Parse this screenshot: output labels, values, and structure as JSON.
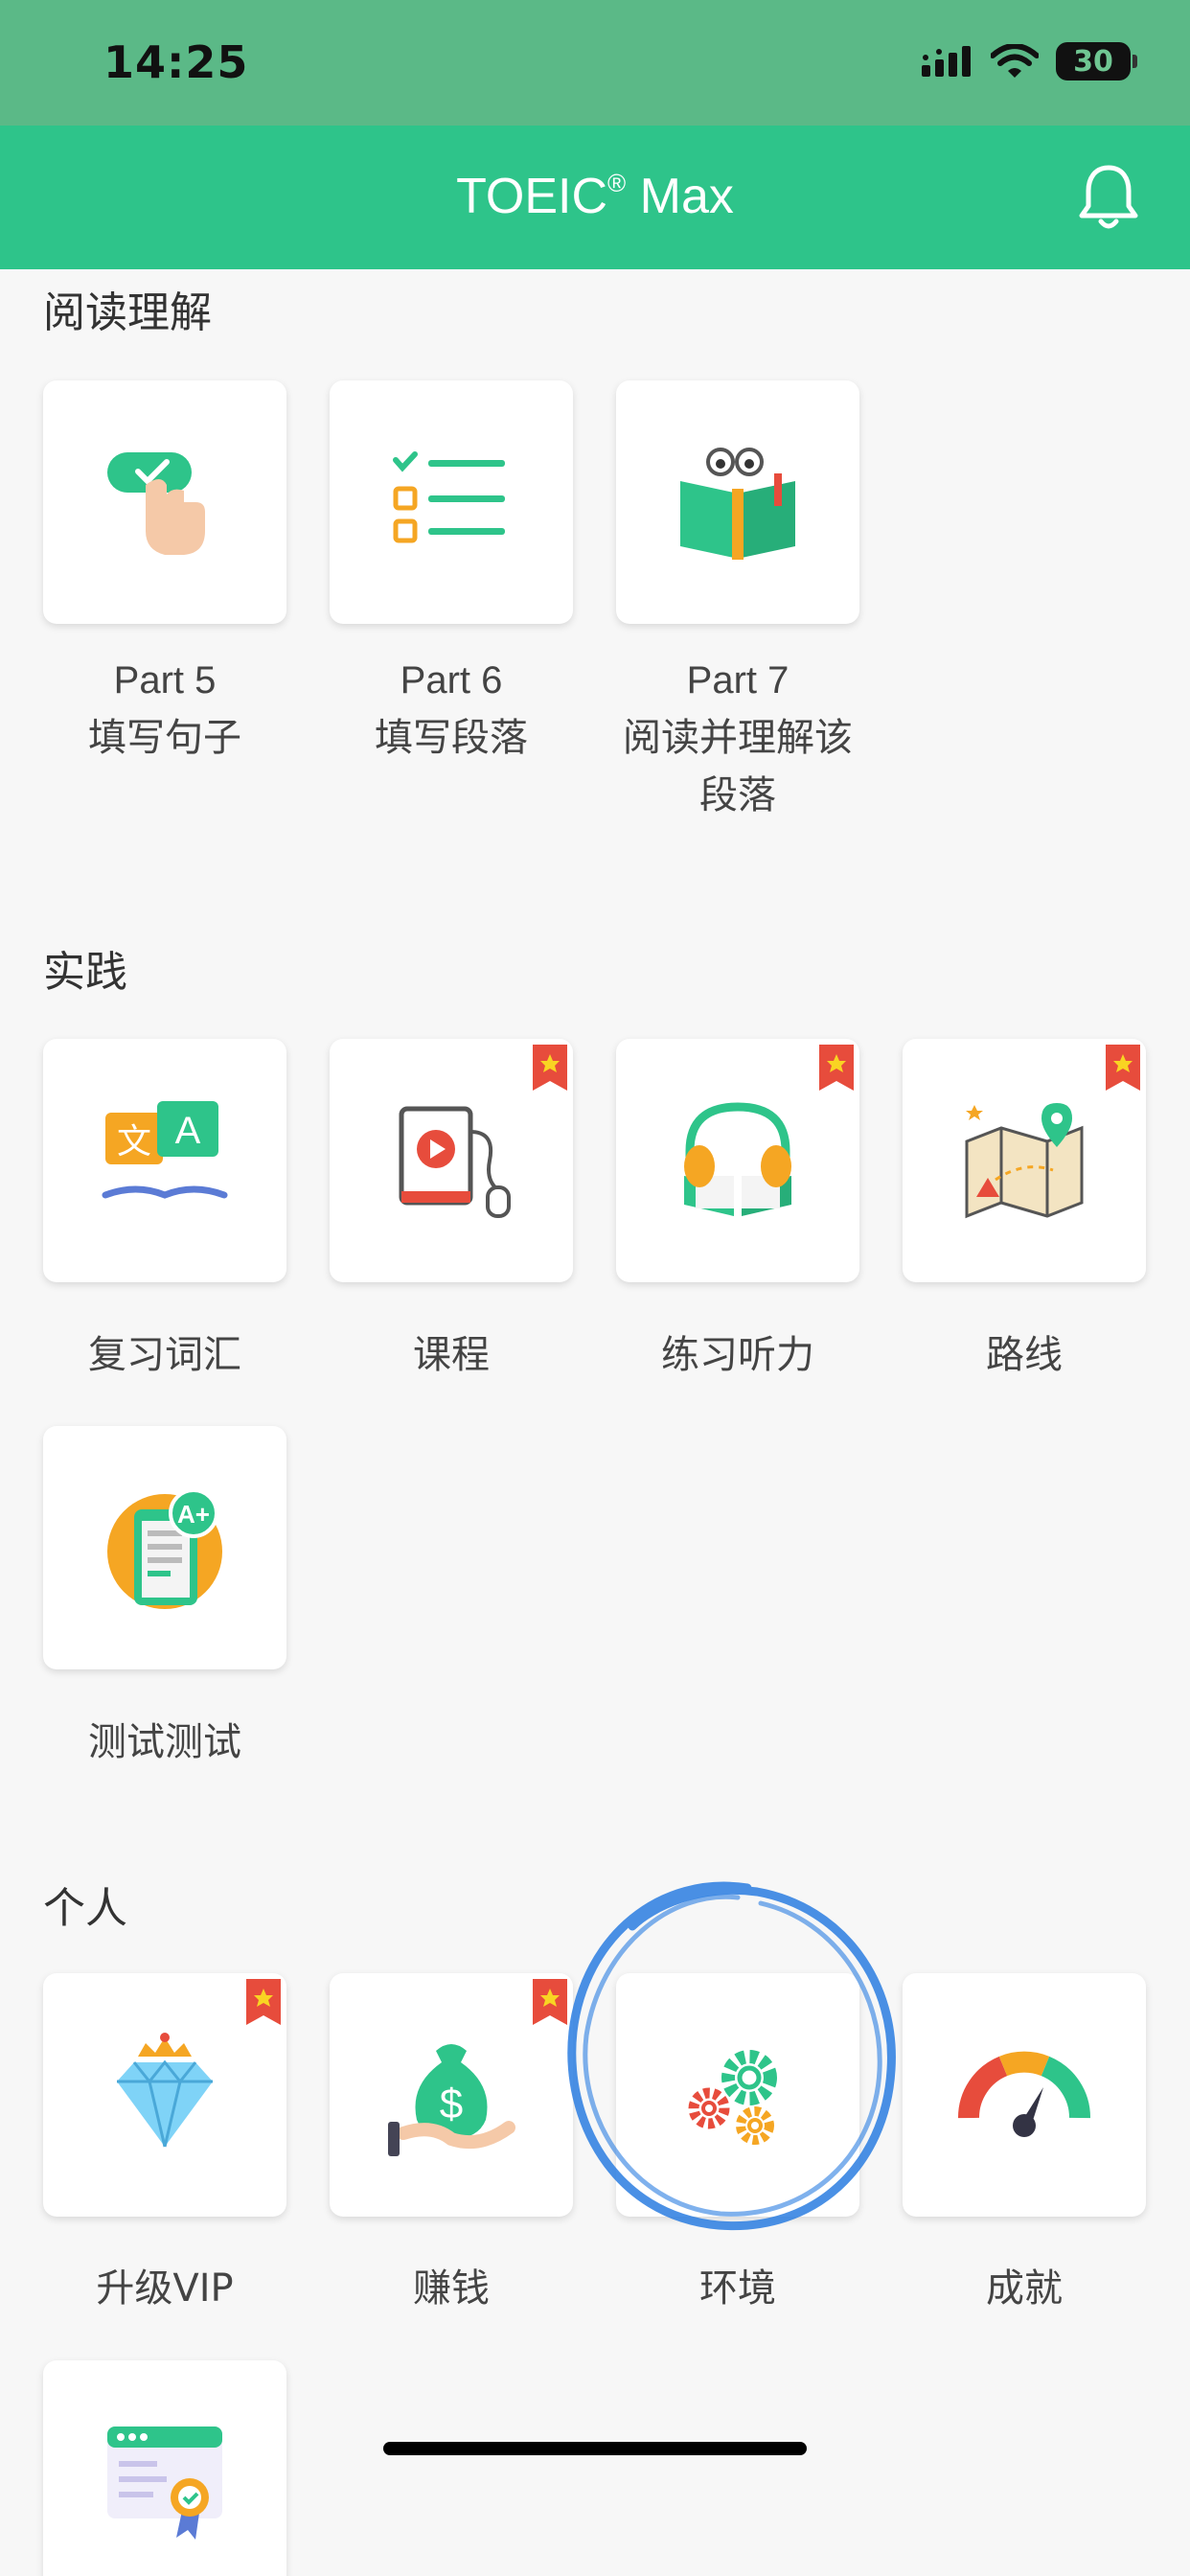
{
  "status_bar": {
    "time": "14:25",
    "battery": "30"
  },
  "header": {
    "title": "TOEIC",
    "title_mark": "®",
    "title_suffix": " Max"
  },
  "sections": {
    "reading": {
      "title": "阅读理解",
      "items": [
        {
          "title": "Part 5",
          "subtitle": "填写句子",
          "icon": "tap-check-icon"
        },
        {
          "title": "Part 6",
          "subtitle": "填写段落",
          "icon": "checklist-icon"
        },
        {
          "title": "Part 7",
          "subtitle": "阅读并理解该",
          "subtitle2": "段落",
          "icon": "book-reading-icon"
        }
      ]
    },
    "practice": {
      "title": "实践",
      "items": [
        {
          "label": "复习词汇",
          "icon": "translate-icon",
          "premium": false
        },
        {
          "label": "课程",
          "icon": "video-course-icon",
          "premium": true
        },
        {
          "label": "练习听力",
          "icon": "headphones-book-icon",
          "premium": true
        },
        {
          "label": "路线",
          "icon": "map-route-icon",
          "premium": true
        },
        {
          "label": "测试测试",
          "icon": "test-grade-icon",
          "premium": false
        }
      ]
    },
    "personal": {
      "title": "个人",
      "items": [
        {
          "label": "升级VIP",
          "icon": "diamond-crown-icon",
          "premium": true
        },
        {
          "label": "赚钱",
          "icon": "money-bag-icon",
          "premium": true
        },
        {
          "label": "环境",
          "icon": "gears-icon",
          "premium": false
        },
        {
          "label": "成就",
          "icon": "gauge-icon",
          "premium": false
        },
        {
          "label": "",
          "icon": "certificate-icon",
          "premium": false
        }
      ]
    }
  },
  "colors": {
    "primary": "#2ec48a",
    "status_bar": "#5bb987",
    "ribbon": "#e74c3c",
    "annotation": "#2a7de1"
  }
}
